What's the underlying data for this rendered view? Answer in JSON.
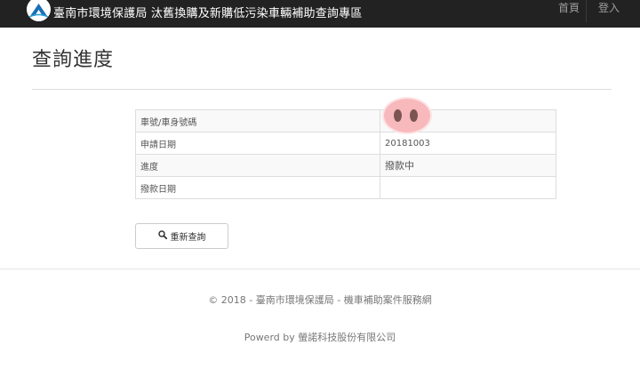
{
  "navbar": {
    "brand": "臺南市環境保護局 汰舊換購及新購低污染車輛補助查詢專區",
    "links": [
      "首頁",
      "登入"
    ]
  },
  "page": {
    "title": "查詢進度"
  },
  "table": {
    "rows": [
      {
        "label": "車號/車身號碼",
        "value": ""
      },
      {
        "label": "申請日期",
        "value": "20181003"
      },
      {
        "label": "進度",
        "value": "撥款中"
      },
      {
        "label": "撥款日期",
        "value": ""
      }
    ]
  },
  "buttons": {
    "requery_label": "重新查詢"
  },
  "footer": {
    "copyright": "© 2018 - 臺南市環境保護局 - 機車補助案件服務網",
    "powered": "Powerd by 螢諾科技股份有限公司"
  },
  "icons": {
    "logo": "tainan-epb-logo",
    "search": "search-icon",
    "redaction": "pig-nose-sticker"
  },
  "colors": {
    "navbar_bg": "#222222",
    "logo_blue": "#1a6fb5",
    "redaction_pink": "#f8b9bd"
  }
}
